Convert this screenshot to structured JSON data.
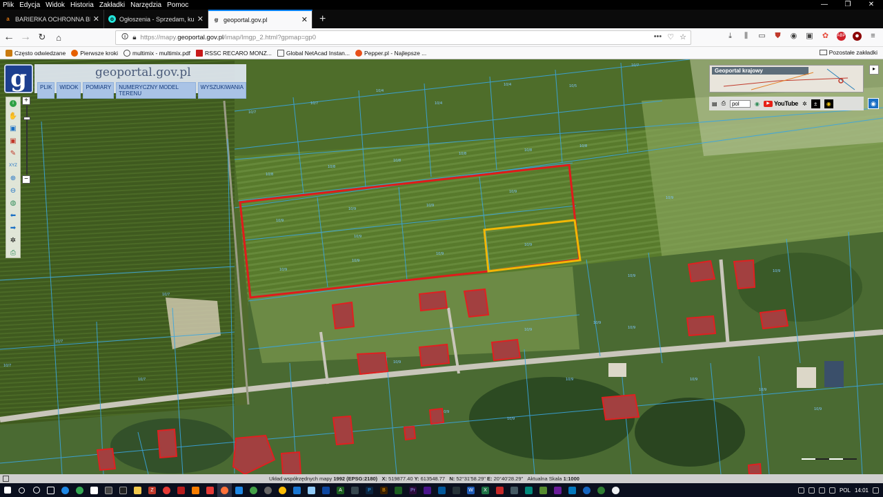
{
  "menu": [
    "Plik",
    "Edycja",
    "Widok",
    "Historia",
    "Zakładki",
    "Narzędzia",
    "Pomoc"
  ],
  "window_controls": [
    "—",
    "❐",
    "✕"
  ],
  "tabs": [
    {
      "label": "BARIERKA OCHRONNA BRAMKA",
      "favicon": "amazon-a-icon",
      "color": "#e47911",
      "active": false
    },
    {
      "label": "Ogłoszenia - Sprzedam, kupię",
      "favicon": "olx-icon",
      "color": "#23e5db",
      "active": false
    },
    {
      "label": "geoportal.gov.pl",
      "favicon": "geoportal-icon",
      "color": "#555555",
      "active": true
    }
  ],
  "new_tab": "+",
  "url": {
    "prefix": "https://mapy.",
    "host": "geoportal.gov.pl",
    "path": "/imap/Imgp_2.html?gpmap=gp0"
  },
  "bookmarks": [
    {
      "label": "Często odwiedzane",
      "color": "#c97a10"
    },
    {
      "label": "Pierwsze kroki",
      "color": "#e66000"
    },
    {
      "label": "multimix - multimix.pdf",
      "color": "#444444"
    },
    {
      "label": "RSSC RECARO MONZ...",
      "color": "#c71919"
    },
    {
      "label": "Global NetAcad Instan...",
      "color": "#555555"
    },
    {
      "label": "Pepper.pl - Najlepsze ...",
      "color": "#e8501a"
    }
  ],
  "bookmarks_other": "Pozostałe zakładki",
  "geoportal": {
    "title_pre": "geo",
    "title_hl": "portal",
    "title_post": ".gov.pl",
    "logo_letter": "g",
    "menu": [
      "PLIK",
      "WIDOK",
      "POMIARY",
      "NUMERYCZNY MODEL TERENU",
      "WYSZUKIWANIA"
    ],
    "overview_label": "Geoportal krajowy",
    "lang": "pol",
    "youtube": "YouTube"
  },
  "status": {
    "prefix": "Układ współrzędnych mapy",
    "crs": "1992 (EPSG:2180)",
    "x_label": "X:",
    "x": "519877.40",
    "y_label": "Y:",
    "y": "613548.77",
    "n_label": "N:",
    "n": "52°31'58.29\"",
    "e_label": "E:",
    "e": "20°40'28.29\"",
    "scale_label": "Aktualna Skala",
    "scale": "1:1000"
  },
  "tray": {
    "lang": "POL",
    "time": "14:01"
  },
  "colors": {
    "parcel_red": "#e01b1b",
    "parcel_yellow": "#f2b705",
    "boundary_blue": "#3aa6e0",
    "building_red": "#e02020"
  }
}
